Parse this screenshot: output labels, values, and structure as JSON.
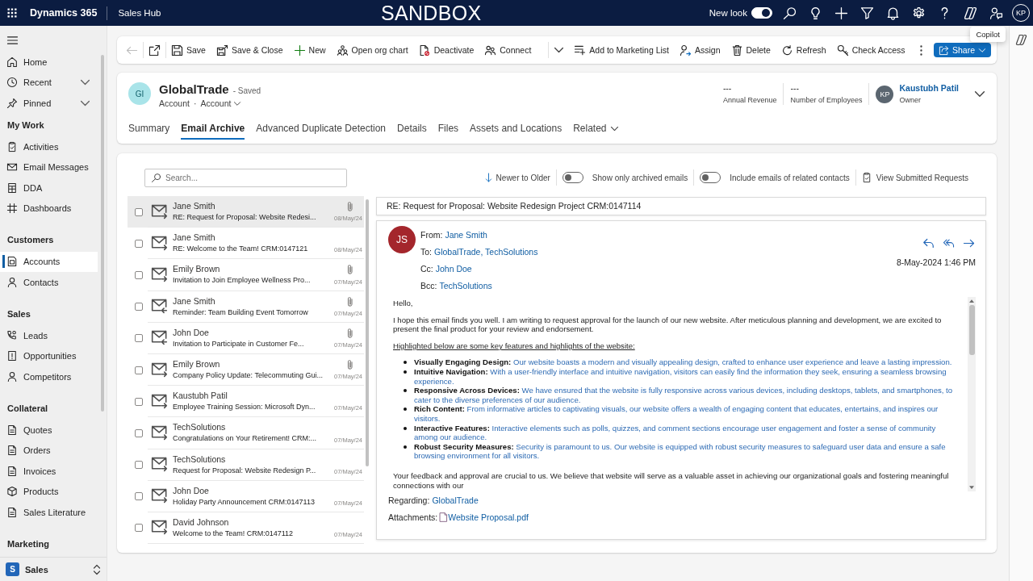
{
  "top_bar": {
    "app_name": "Dynamics 365",
    "area_name": "Sales Hub",
    "environment": "SANDBOX",
    "new_look": {
      "label": "New look",
      "on": true
    },
    "user_initials": "KP"
  },
  "sidebar": {
    "top_items": [
      {
        "label": "Home",
        "kind": "link",
        "selected": false
      },
      {
        "label": "Recent",
        "kind": "flyout",
        "selected": false
      },
      {
        "label": "Pinned",
        "kind": "flyout",
        "selected": false
      }
    ],
    "sections": [
      {
        "title": "My Work",
        "items": [
          {
            "label": "Activities",
            "selected": false
          },
          {
            "label": "Email Messages",
            "selected": false
          },
          {
            "label": "DDA",
            "selected": false
          },
          {
            "label": "Dashboards",
            "selected": false
          }
        ]
      },
      {
        "title": "Customers",
        "items": [
          {
            "label": "Accounts",
            "selected": true
          },
          {
            "label": "Contacts",
            "selected": false
          }
        ]
      },
      {
        "title": "Sales",
        "items": [
          {
            "label": "Leads",
            "selected": false
          },
          {
            "label": "Opportunities",
            "selected": false
          },
          {
            "label": "Competitors",
            "selected": false
          }
        ]
      },
      {
        "title": "Collateral",
        "items": [
          {
            "label": "Quotes",
            "selected": false
          },
          {
            "label": "Orders",
            "selected": false
          },
          {
            "label": "Invoices",
            "selected": false
          },
          {
            "label": "Products",
            "selected": false
          },
          {
            "label": "Sales Literature",
            "selected": false
          }
        ]
      },
      {
        "title": "Marketing"
      }
    ],
    "area_switcher": {
      "badge": "S",
      "label": "Sales"
    }
  },
  "command_bar": {
    "back_button": {
      "disabled": true
    },
    "commands": [
      {
        "label": "Save",
        "kind": "button"
      },
      {
        "label": "Save & Close",
        "kind": "button"
      },
      {
        "label": "New",
        "kind": "button"
      },
      {
        "label": "Open org chart",
        "kind": "button"
      },
      {
        "label": "Deactivate",
        "kind": "button"
      },
      {
        "label": "Connect",
        "kind": "split"
      },
      {
        "label": "Add to Marketing List",
        "kind": "button"
      },
      {
        "label": "Assign",
        "kind": "button"
      },
      {
        "label": "Delete",
        "kind": "button"
      },
      {
        "label": "Refresh",
        "kind": "button"
      },
      {
        "label": "Check Access",
        "kind": "button"
      }
    ],
    "share_label": "Share"
  },
  "copilot_pane": {
    "tooltip": "Copilot"
  },
  "record": {
    "initials": "GI",
    "name": "GlobalTrade",
    "save_status": "- Saved",
    "entity": "Account",
    "separator": "·",
    "form": "Account",
    "fields": [
      {
        "value": "---",
        "label": "Annual Revenue"
      },
      {
        "value": "---",
        "label": "Number of Employees"
      }
    ],
    "owner": {
      "initials": "KP",
      "name": "Kaustubh Patil",
      "label": "Owner"
    },
    "tabs": [
      {
        "label": "Summary",
        "kind": "tab",
        "selected": false
      },
      {
        "label": "Email Archive",
        "kind": "tab",
        "selected": true
      },
      {
        "label": "Advanced Duplicate Detection",
        "kind": "tab",
        "selected": false
      },
      {
        "label": "Details",
        "kind": "tab",
        "selected": false
      },
      {
        "label": "Files",
        "kind": "tab",
        "selected": false
      },
      {
        "label": "Assets and Locations",
        "kind": "tab",
        "selected": false
      },
      {
        "label": "Related",
        "kind": "menu",
        "selected": false
      }
    ]
  },
  "email_archive": {
    "search": {
      "placeholder": "Search..."
    },
    "sort": {
      "label": "Newer to Older"
    },
    "toggles": [
      {
        "label": "Show only archived emails",
        "on": false
      },
      {
        "label": "Include emails of related contacts",
        "on": false
      }
    ],
    "requests_link": "View Submitted Requests",
    "emails": [
      {
        "sender": "Jane Smith",
        "subject": "RE: Request for Proposal: Website Redesi...",
        "date": "08/May/24",
        "kind": "outgoing",
        "attachment": true,
        "selected": true,
        "checked": false
      },
      {
        "sender": "Jane Smith",
        "subject": "RE: Welcome to the Team! CRM:0147121",
        "date": "08/May/24",
        "kind": "outgoing",
        "attachment": false,
        "selected": false,
        "checked": false
      },
      {
        "sender": "Emily Brown",
        "subject": "Invitation to Join Employee Wellness Pro...",
        "date": "07/May/24",
        "kind": "outgoing",
        "attachment": true,
        "selected": false,
        "checked": false
      },
      {
        "sender": "Jane Smith",
        "subject": "Reminder: Team Building Event Tomorrow",
        "date": "07/May/24",
        "kind": "incoming",
        "attachment": true,
        "selected": false,
        "checked": false
      },
      {
        "sender": "John Doe",
        "subject": "Invitation to Participate in Customer Fe...",
        "date": "07/May/24",
        "kind": "incoming",
        "attachment": true,
        "selected": false,
        "checked": false
      },
      {
        "sender": "Emily Brown",
        "subject": "Company Policy Update: Telecommuting Gui...",
        "date": "07/May/24",
        "kind": "outgoing",
        "attachment": true,
        "selected": false,
        "checked": false
      },
      {
        "sender": "Kaustubh Patil",
        "subject": "Employee Training Session: Microsoft Dyn...",
        "date": "07/May/24",
        "kind": "outgoing",
        "attachment": false,
        "selected": false,
        "checked": false
      },
      {
        "sender": "TechSolutions",
        "subject": "Congratulations on Your Retirement! CRM:...",
        "date": "07/May/24",
        "kind": "outgoing",
        "attachment": false,
        "selected": false,
        "checked": false
      },
      {
        "sender": "TechSolutions",
        "subject": "Request for Proposal: Website Redesign P...",
        "date": "07/May/24",
        "kind": "outgoing",
        "attachment": false,
        "selected": false,
        "checked": false
      },
      {
        "sender": "John Doe",
        "subject": "Holiday Party Announcement CRM:0147113",
        "date": "07/May/24",
        "kind": "outgoing",
        "attachment": false,
        "selected": false,
        "checked": false
      },
      {
        "sender": "David Johnson",
        "subject": "Welcome to the Team! CRM:0147112",
        "date": "07/May/24",
        "kind": "outgoing",
        "attachment": false,
        "selected": false,
        "checked": false
      }
    ],
    "reading_pane": {
      "subject": "RE: Request for Proposal: Website Redesign Project CRM:0147114",
      "sender_initials": "JS",
      "headers": [
        {
          "label": "From:",
          "value": "Jane Smith"
        },
        {
          "label": "To:",
          "value": "GlobalTrade, TechSolutions"
        },
        {
          "label": "Cc:",
          "value": "John Doe"
        },
        {
          "label": "Bcc:",
          "value": "TechSolutions"
        }
      ],
      "sent": "8-May-2024 1:46 PM",
      "body": [
        {
          "kind": "paragraph",
          "text": "Hello,"
        },
        {
          "kind": "paragraph",
          "text": "I hope this email finds you well. I am writing to request approval for the launch of our new website. After meticulous planning and development, we are excited to present the final product for your review and endorsement."
        },
        {
          "kind": "heading",
          "text": "Highlighted below are some key features and highlights of the website:"
        },
        {
          "kind": "list",
          "items": [
            "**Visually Engaging Design:** Our website boasts a modern and visually appealing design, crafted to enhance user experience and leave a lasting impression.",
            "**Intuitive Navigation:** With a user-friendly interface and intuitive navigation, visitors can easily find the information they seek, ensuring a seamless browsing experience.",
            "**Responsive Across Devices:** We have ensured that the website is fully responsive across various devices, including desktops, tablets, and smartphones, to cater to the diverse preferences of our audience.",
            "**Rich Content:** From informative articles to captivating visuals, our website offers a wealth of engaging content that educates, entertains, and inspires our visitors.",
            "**Interactive Features:** Interactive elements such as polls, quizzes, and comment sections encourage user engagement and foster a sense of community among our audience.",
            "**Robust Security Measures:** Security is paramount to us. Our website is equipped with robust security measures to safeguard user data and ensure a safe browsing environment for all visitors."
          ]
        },
        {
          "kind": "paragraph",
          "text": "Your feedback and approval are crucial to us. We believe that website will serve as a valuable asset in achieving our organizational goals and fostering meaningful connections with our"
        }
      ],
      "regarding": {
        "label": "Regarding:",
        "value": "GlobalTrade"
      },
      "attachments": {
        "label": "Attachments:",
        "file": "Website Proposal.pdf"
      }
    }
  }
}
